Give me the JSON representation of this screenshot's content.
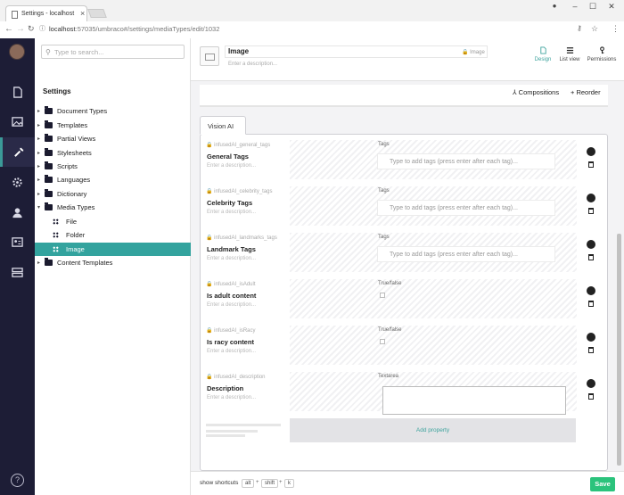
{
  "browser": {
    "tab_title": "Settings - localhost",
    "url_host": "localhost",
    "url_rest": ":57035/umbraco#/settings/mediaTypes/edit/1032"
  },
  "search": {
    "placeholder": "Type to search..."
  },
  "tree": {
    "header": "Settings",
    "items": [
      {
        "label": "Document Types",
        "kind": "folder",
        "expandable": true
      },
      {
        "label": "Templates",
        "kind": "folder",
        "expandable": true
      },
      {
        "label": "Partial Views",
        "kind": "folder",
        "expandable": true
      },
      {
        "label": "Stylesheets",
        "kind": "folder",
        "expandable": true
      },
      {
        "label": "Scripts",
        "kind": "folder",
        "expandable": true
      },
      {
        "label": "Languages",
        "kind": "folder",
        "expandable": true
      },
      {
        "label": "Dictionary",
        "kind": "folder",
        "expandable": true
      },
      {
        "label": "Media Types",
        "kind": "folder",
        "expandable": true,
        "expanded": true
      },
      {
        "label": "File",
        "kind": "type"
      },
      {
        "label": "Folder",
        "kind": "type"
      },
      {
        "label": "Image",
        "kind": "type",
        "selected": true
      },
      {
        "label": "Content Templates",
        "kind": "folder",
        "expandable": true
      }
    ]
  },
  "editor": {
    "name": "Image",
    "alias": "Image",
    "description_placeholder": "Enter a description...",
    "apps": [
      {
        "label": "Design",
        "icon": "document-icon",
        "active": true
      },
      {
        "label": "List view",
        "icon": "list-icon"
      },
      {
        "label": "Permissions",
        "icon": "key-icon"
      }
    ],
    "toolbar": {
      "compositions": "Compositions",
      "reorder": "Reorder"
    },
    "group_tab": "Vision AI",
    "properties": [
      {
        "alias": "infusedAI_general_tags",
        "name": "General Tags",
        "type": "Tags",
        "input": "tags",
        "placeholder": "Type to add tags (press enter after each tag)..."
      },
      {
        "alias": "infusedAI_celebrity_tags",
        "name": "Celebrity Tags",
        "type": "Tags",
        "input": "tags",
        "placeholder": "Type to add tags (press enter after each tag)..."
      },
      {
        "alias": "infusedAI_landmarks_tags",
        "name": "Landmark Tags",
        "type": "Tags",
        "input": "tags",
        "placeholder": "Type to add tags (press enter after each tag)..."
      },
      {
        "alias": "infusedAI_isAdult",
        "name": "Is adult content",
        "type": "True/false",
        "input": "checkbox"
      },
      {
        "alias": "infusedAI_isRacy",
        "name": "Is racy content",
        "type": "True/false",
        "input": "checkbox"
      },
      {
        "alias": "infusedAI_description",
        "name": "Description",
        "type": "Textarea",
        "input": "textarea"
      }
    ],
    "property_description": "Enter a description...",
    "add_property": "Add property"
  },
  "footer": {
    "shortcuts_label": "show shortcuts",
    "keys": [
      "alt",
      "shift",
      "k"
    ],
    "save": "Save"
  },
  "colors": {
    "accent": "#3ea39d",
    "save": "#2bc37c",
    "sidebar": "#1d1d36"
  }
}
